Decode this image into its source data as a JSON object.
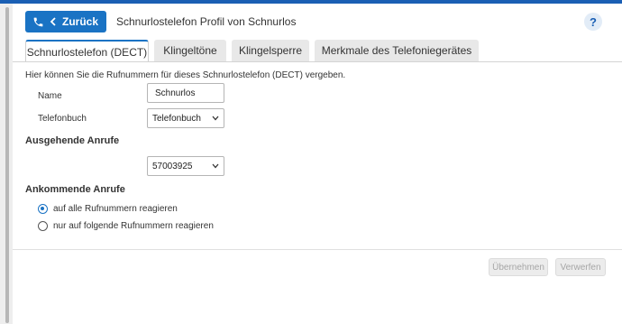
{
  "header": {
    "back_label": "Zurück",
    "title": "Schnurlostelefon Profil von Schnurlos",
    "help": "?"
  },
  "tabs": [
    {
      "label": "Schnurlostelefon (DECT)",
      "active": true
    },
    {
      "label": "Klingeltöne",
      "active": false
    },
    {
      "label": "Klingelsperre",
      "active": false
    },
    {
      "label": "Merkmale des Telefoniegerätes",
      "active": false
    }
  ],
  "form": {
    "intro": "Hier können Sie die Rufnummern für dieses Schnurlostelefon (DECT) vergeben.",
    "name_label": "Name",
    "name_value": "Schnurlos",
    "phonebook_label": "Telefonbuch",
    "phonebook_value": "Telefonbuch",
    "outgoing_heading": "Ausgehende Anrufe",
    "outgoing_value": "57003925",
    "incoming_heading": "Ankommende Anrufe",
    "radio_all": "auf alle Rufnummern reagieren",
    "radio_following": "nur auf folgende Rufnummern reagieren",
    "selected_radio": "all"
  },
  "footer": {
    "apply_label": "Übernehmen",
    "discard_label": "Verwerfen"
  },
  "colors": {
    "accent": "#1a73c4",
    "topbar": "#1a5fb4"
  }
}
